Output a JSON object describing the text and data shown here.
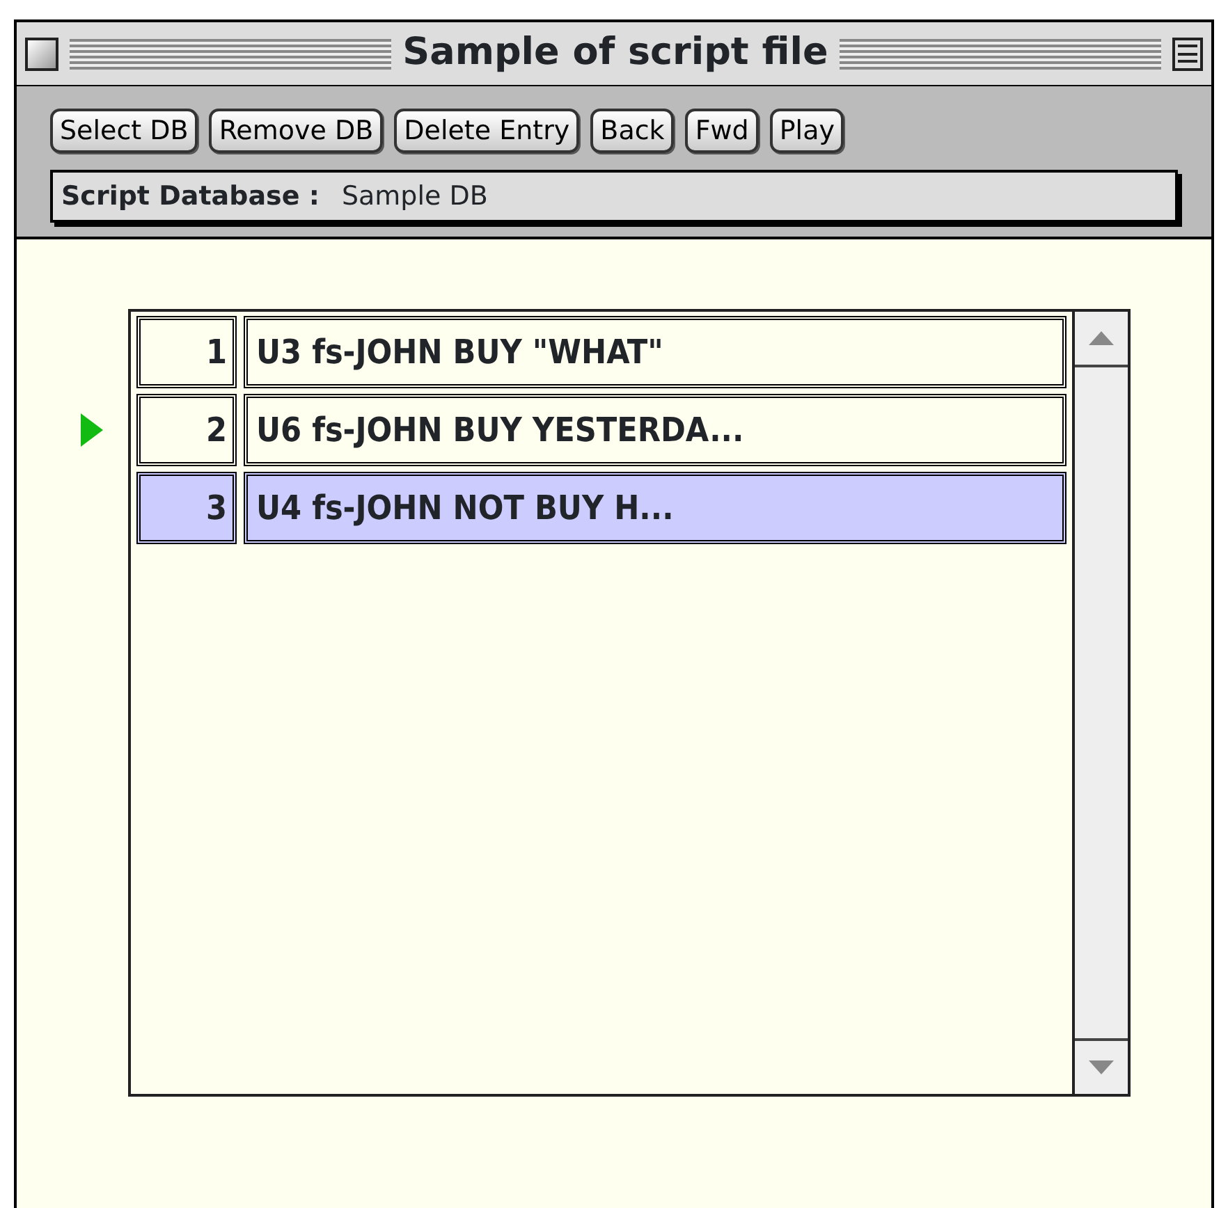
{
  "window": {
    "title": "Sample of script file"
  },
  "toolbar": {
    "buttons": [
      "Select DB",
      "Remove DB",
      "Delete Entry",
      "Back",
      "Fwd",
      "Play"
    ]
  },
  "database": {
    "label": "Script Database :",
    "value": "Sample DB"
  },
  "script_list": {
    "rows": [
      {
        "number": "1",
        "text": "U3 fs-JOHN BUY \"WHAT\"",
        "current": false,
        "selected": false
      },
      {
        "number": "2",
        "text": "U6 fs-JOHN BUY YESTERDA...",
        "current": true,
        "selected": false
      },
      {
        "number": "3",
        "text": "U4 fs-JOHN NOT BUY H...",
        "current": false,
        "selected": true
      }
    ]
  }
}
